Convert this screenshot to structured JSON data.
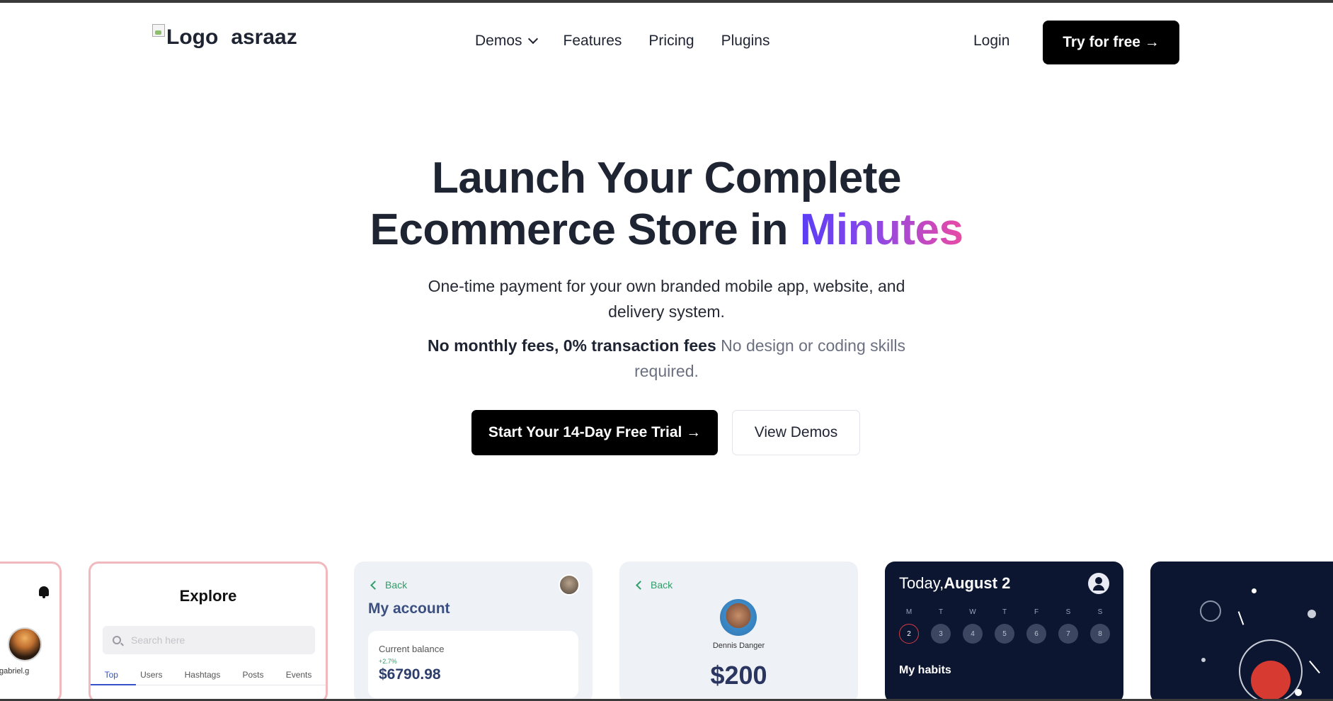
{
  "nav": {
    "logo_alt": "Logo",
    "brand": "asraaz",
    "items": [
      "Demos",
      "Features",
      "Pricing",
      "Plugins"
    ],
    "login": "Login",
    "try_label": "Try for free →"
  },
  "hero": {
    "title_line1": "Launch Your Complete",
    "title_line2_pre": "Ecommerce Store in ",
    "title_line2_accent": "Minutes",
    "subtitle": "One-time payment for your own branded mobile app, website, and delivery system.",
    "bold_note": "No monthly fees, 0% transaction fees",
    "light_note": "No design or coding skills required.",
    "cta_primary": "Start Your 14-Day Free Trial →",
    "cta_secondary": "View Demos"
  },
  "colors": {
    "accent_gradient_start": "#5b3df5",
    "accent_gradient_end": "#ea4aa3",
    "primary_button": "#000000",
    "card_border_pink": "#f0b9bd",
    "dark_card": "#0c1630"
  },
  "cards": {
    "profile": {
      "username": "gabriel.g",
      "icon": "bell-icon"
    },
    "explore": {
      "title": "Explore",
      "search_placeholder": "Search here",
      "tabs": [
        "Top",
        "Users",
        "Hashtags",
        "Posts",
        "Events"
      ]
    },
    "account": {
      "back": "Back",
      "title": "My account",
      "balance_label": "Current balance",
      "balance_delta": "+2.7%",
      "balance_value": "$6790.98"
    },
    "transfer": {
      "back": "Back",
      "name": "Dennis Danger",
      "amount": "$200"
    },
    "habits": {
      "today_prefix": "Today,",
      "today_date": "August 2",
      "weekdays": [
        "M",
        "T",
        "W",
        "T",
        "F",
        "S",
        "S"
      ],
      "dates": [
        "2",
        "3",
        "4",
        "5",
        "6",
        "7",
        "8"
      ],
      "section": "My habits"
    }
  }
}
